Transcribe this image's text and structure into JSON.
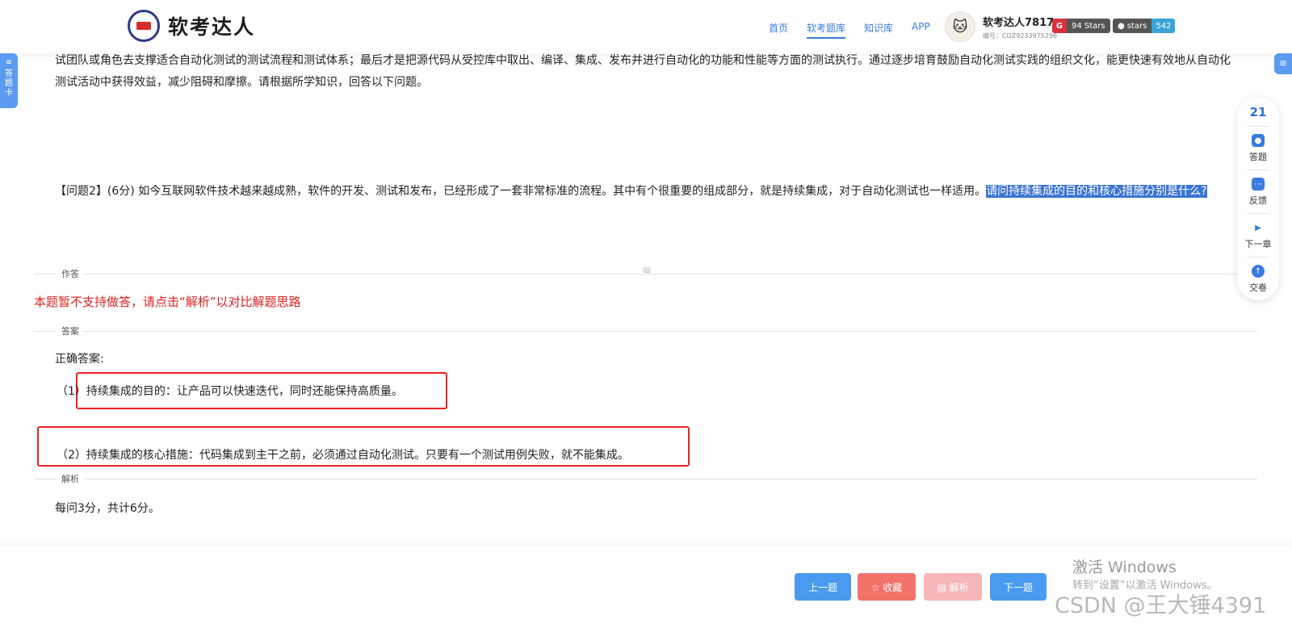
{
  "header": {
    "logo_text": "软考达人",
    "nav": [
      "首页",
      "软考题库",
      "知识库",
      "APP"
    ],
    "active_nav": "软考题库",
    "user": {
      "name": "软考达人7817",
      "id": "编号：CDZ9233975296"
    },
    "badges": [
      {
        "icon": "G",
        "text": "94 Stars"
      },
      {
        "left": "stars",
        "right": "542"
      }
    ]
  },
  "side_tab": {
    "label": "答题卡"
  },
  "content": {
    "intro": "试团队或角色去支撑适合自动化测试的测试流程和测试体系；最后才是把源代码从受控库中取出、编译、集成、发布并进行自动化的功能和性能等方面的测试执行。通过逐步培育鼓励自动化测试实践的组织文化，能更快速有效地从自动化测试活动中获得效益，减少阻碍和摩擦。请根据所学知识，回答以下问题。",
    "question_prefix": "【问题2】(6分) 如今互联网软件技术越来越成熟，软件的开发、测试和发布，已经形成了一套非常标准的流程。其中有个很重要的组成部分，就是持续集成，对于自动化测试也一样适用。",
    "question_highlight": "请问持续集成的目的和核心措施分别是什么?",
    "section_zuoda": "作答",
    "notice": "本题暂不支持做答，请点击“解析”以对比解题思路",
    "section_answer": "答案",
    "answer_title": "正确答案:",
    "answer_1": "（1）持续集成的目的：让产品可以快速迭代，同时还能保持高质量。",
    "answer_2": "（2）持续集成的核心措施：代码集成到主干之前，必须通过自动化测试。只要有一个测试用例失败，就不能集成。",
    "section_analysis": "解析",
    "analysis": "每问3分，共计6分。"
  },
  "float_panel": {
    "number": "21",
    "items": [
      "答题",
      "反馈",
      "下一章",
      "交卷"
    ]
  },
  "bottom": {
    "prev": "上一题",
    "fav": "☆ 收藏",
    "analysis": "▤ 解析",
    "next": "下一题"
  },
  "watermark": {
    "line1": "激活 Windows",
    "line2": "转到“设置”以激活 Windows。",
    "line3": "CSDN @王大锤4391"
  }
}
